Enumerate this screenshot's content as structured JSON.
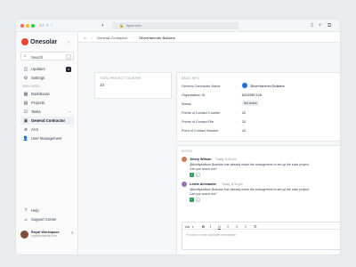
{
  "browser": {
    "url": "figma.com",
    "traffic_lights": [
      "#ff5f57",
      "#febc2e",
      "#28c840"
    ]
  },
  "sidebar": {
    "logo_text": "Onesolar",
    "search": {
      "label": "Search",
      "shortcut": "/"
    },
    "top_items": [
      {
        "label": "Updates",
        "icon": "updates-icon",
        "badge": "4"
      },
      {
        "label": "Settings",
        "icon": "gear-icon"
      }
    ],
    "section_label": "MAIN MENU",
    "menu_items": [
      {
        "label": "Dashboard",
        "icon": "dashboard-icon"
      },
      {
        "label": "Projects",
        "icon": "projects-icon"
      },
      {
        "label": "Tasks",
        "icon": "tasks-icon"
      },
      {
        "label": "General Contractor",
        "icon": "contractor-icon",
        "active": true
      },
      {
        "label": "AHJ",
        "icon": "ahj-icon"
      },
      {
        "label": "User Management",
        "icon": "user-icon"
      }
    ],
    "bottom_items": [
      {
        "label": "Help",
        "icon": "help-icon"
      },
      {
        "label": "Support Center",
        "icon": "support-icon"
      }
    ],
    "workspace": {
      "name": "Royal Workspace",
      "email": "royal@onesolar.com"
    }
  },
  "breadcrumb": {
    "items": [
      "General Contractor",
      "SilverHammer Builders"
    ]
  },
  "total_card": {
    "title": "TOTAL PROJECT COUNTER",
    "value": "10"
  },
  "basic_info": {
    "title": "BASIC INFO",
    "rows": [
      {
        "label": "General Contractor Name",
        "value": "SilverHammer Builders"
      },
      {
        "label": "Organisation ID",
        "value": "8203SB7126"
      },
      {
        "label": "Status",
        "value": "Not Active"
      },
      {
        "label": "Points of Contact Counter",
        "value": "22"
      },
      {
        "label": "Points of Contact File",
        "value": "22"
      },
      {
        "label": "Point of Contact Number",
        "value": "22"
      }
    ]
  },
  "notes": {
    "title": "NOTES",
    "items": [
      {
        "name": "Jenny Wilson",
        "time": "Today, 8:34 pm",
        "body": "@kimilyawilson Brandon has already made the arrangement to set up the solar project. Can you reach out?",
        "avatar_color": "#c97b5a"
      },
      {
        "name": "Leslie Alexander",
        "time": "Today, 8:34 pm",
        "body": "@kimilyawilson Brandon has already made the arrangement to set up the solar project. Can you reach out?",
        "avatar_color": "#9b6fb5"
      }
    ],
    "editor": {
      "format_label": "Aa",
      "placeholder": "Produce a note and later description"
    }
  }
}
